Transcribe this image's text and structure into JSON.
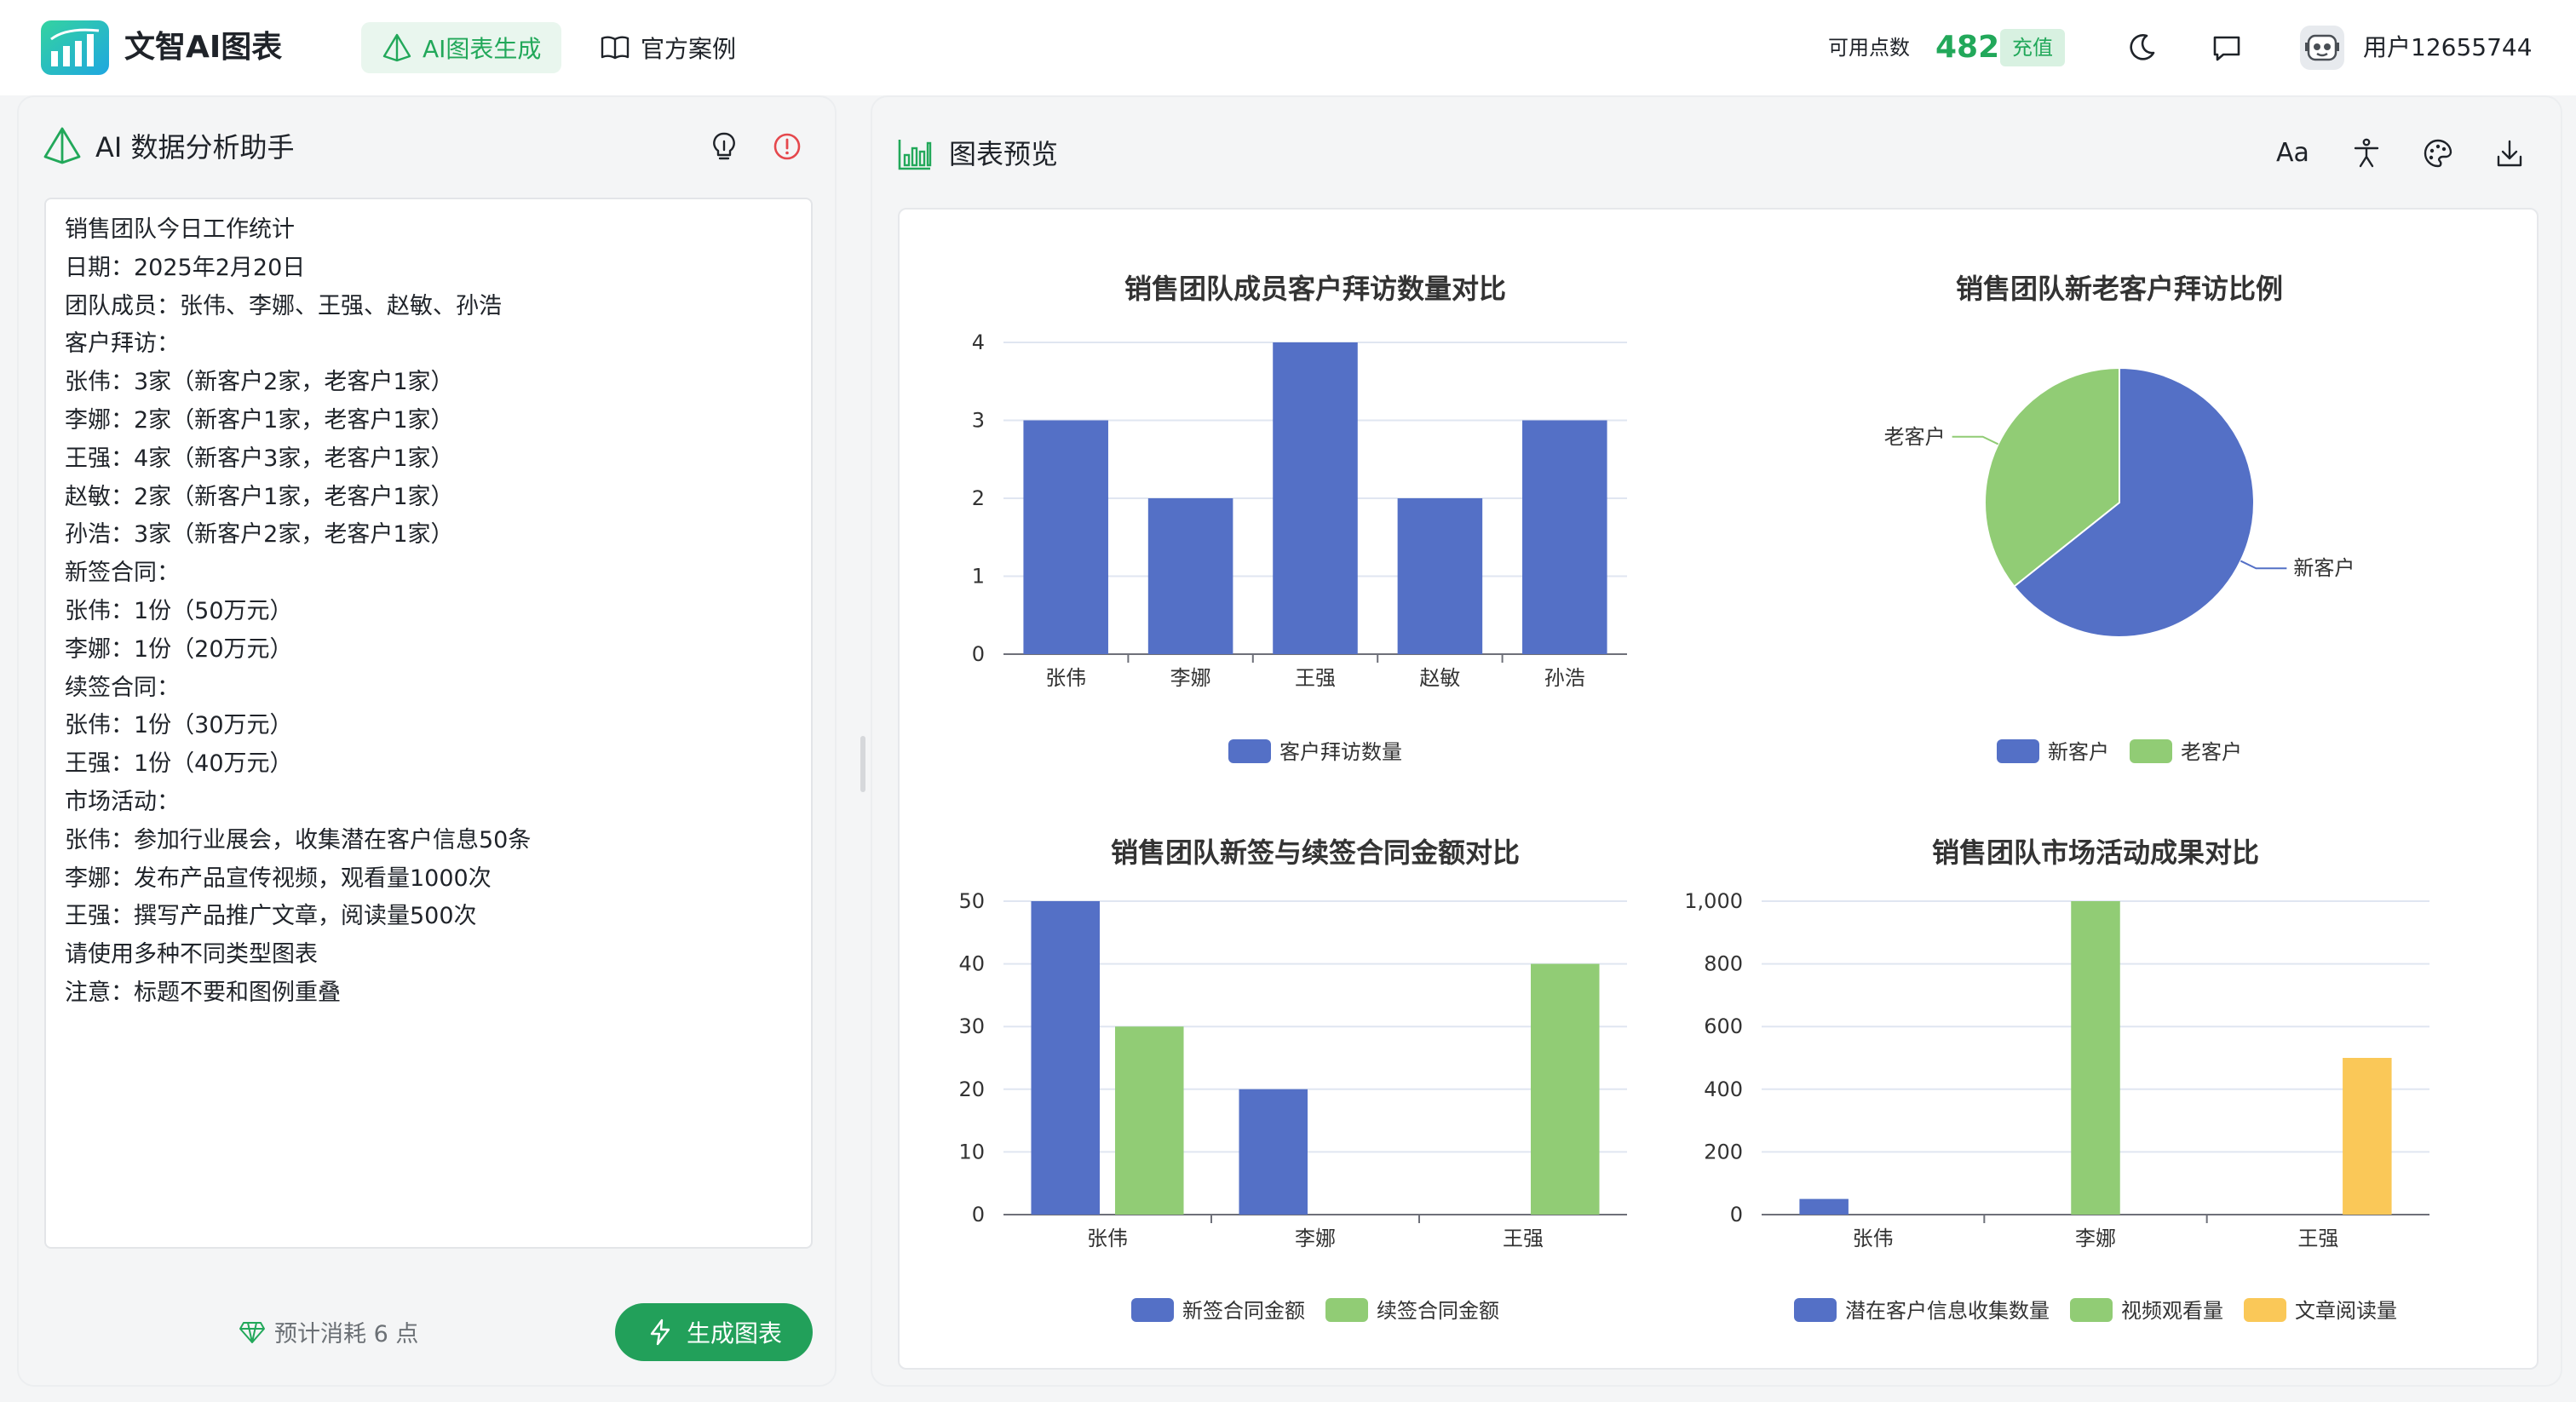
{
  "header": {
    "brand": "文智AI图表",
    "nav": [
      {
        "label": "AI图表生成",
        "active": true
      },
      {
        "label": "官方案例",
        "active": false
      }
    ],
    "points_label": "可用点数",
    "points_value": "482",
    "recharge_label": "充值",
    "username": "用户12655744"
  },
  "left_panel": {
    "title": "AI 数据分析助手",
    "editor_lines": [
      "销售团队今日工作统计",
      "日期：2025年2月20日",
      "团队成员：张伟、李娜、王强、赵敏、孙浩",
      "客户拜访：",
      "张伟：3家（新客户2家，老客户1家）",
      "李娜：2家（新客户1家，老客户1家）",
      "王强：4家（新客户3家，老客户1家）",
      "赵敏：2家（新客户1家，老客户1家）",
      "孙浩：3家（新客户2家，老客户1家）",
      "新签合同：",
      "张伟：1份（50万元）",
      "李娜：1份（20万元）",
      "续签合同：",
      "张伟：1份（30万元）",
      "王强：1份（40万元）",
      "市场活动：",
      "张伟：参加行业展会，收集潜在客户信息50条",
      "李娜：发布产品宣传视频，观看量1000次",
      "王强：撰写产品推广文章，阅读量500次",
      "请使用多种不同类型图表",
      "注意：标题不要和图例重叠"
    ],
    "cost_label": "预计消耗 6 点",
    "generate_label": "生成图表"
  },
  "right_panel": {
    "title": "图表预览",
    "font_tool": "Aa"
  },
  "colors": {
    "accent": "#22a85a",
    "series_blue": "#5470c6",
    "series_green": "#91cc75",
    "series_yellow": "#fac858"
  },
  "chart_data": [
    {
      "type": "bar",
      "title": "销售团队成员客户拜访数量对比",
      "categories": [
        "张伟",
        "李娜",
        "王强",
        "赵敏",
        "孙浩"
      ],
      "series": [
        {
          "name": "客户拜访数量",
          "values": [
            3,
            2,
            4,
            2,
            3
          ]
        }
      ],
      "ylim": [
        0,
        4
      ],
      "yticks": [
        "0",
        "1",
        "2",
        "3",
        "4"
      ],
      "legend": "bottom",
      "grid": true
    },
    {
      "type": "pie",
      "title": "销售团队新老客户拜访比例",
      "slices": [
        {
          "name": "新客户",
          "value": 9
        },
        {
          "name": "老客户",
          "value": 5
        }
      ],
      "legend": "bottom"
    },
    {
      "type": "bar",
      "title": "销售团队新签与续签合同金额对比",
      "categories": [
        "张伟",
        "李娜",
        "王强"
      ],
      "series": [
        {
          "name": "新签合同金额",
          "values": [
            50,
            20,
            0
          ]
        },
        {
          "name": "续签合同金额",
          "values": [
            30,
            0,
            40
          ]
        }
      ],
      "ylim": [
        0,
        50
      ],
      "yticks": [
        "0",
        "10",
        "20",
        "30",
        "40",
        "50"
      ],
      "legend": "bottom",
      "grid": true
    },
    {
      "type": "bar",
      "title": "销售团队市场活动成果对比",
      "categories": [
        "张伟",
        "李娜",
        "王强"
      ],
      "series": [
        {
          "name": "潜在客户信息收集数量",
          "values": [
            50,
            0,
            0
          ]
        },
        {
          "name": "视频观看量",
          "values": [
            0,
            1000,
            0
          ]
        },
        {
          "name": "文章阅读量",
          "values": [
            0,
            0,
            500
          ]
        }
      ],
      "ylim": [
        0,
        1000
      ],
      "yticks": [
        "0",
        "200",
        "400",
        "600",
        "800",
        "1,000"
      ],
      "legend": "bottom",
      "grid": true
    }
  ]
}
